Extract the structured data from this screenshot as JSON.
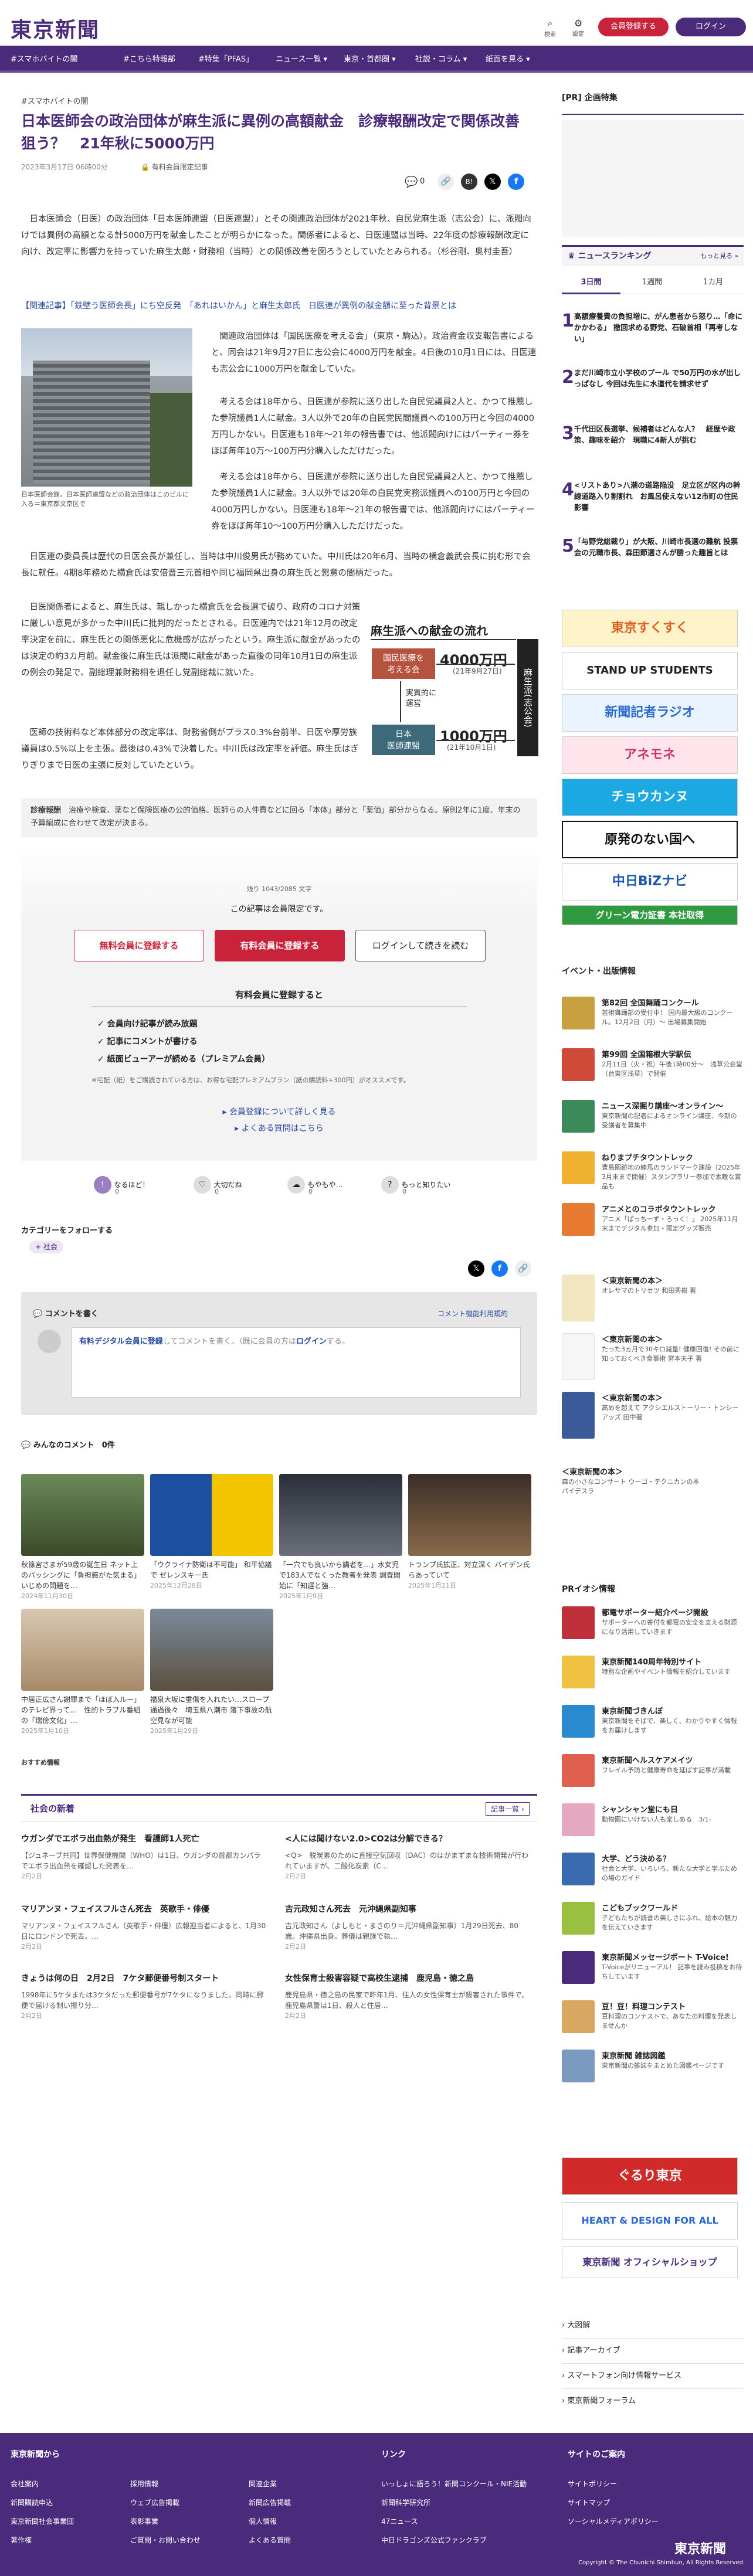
{
  "header": {
    "logo": "東京新聞",
    "search": "検索",
    "settings": "設定",
    "signup": "会員登録する",
    "login": "ログイン"
  },
  "nav": [
    "#スマホバイトの闇",
    "#こちら特報部",
    "#特集「PFAS」",
    "ニュース一覧 ▾",
    "東京・首都圏 ▾",
    "社説・コラム ▾",
    "紙面を見る ▾"
  ],
  "article": {
    "tag": "#スマホバイトの闇",
    "title": "日本医師会の政治団体が麻生派に異例の高額献金　診療報酬改定で関係改善狙う？　21年秋に5000万円",
    "date": "2023年3月17日 06時00分",
    "members_only": "有料会員限定記事",
    "lead": "日本医師会（日医）の政治団体「日本医師連盟（日医連盟）」とその関連政治団体が2021年秋、自民党麻生派（志公会）に、派閥向けでは異例の高額となる計5000万円を献金したことが明らかになった。関係者によると、日医連盟は当時、22年度の診療報酬改定に向け、改定率に影響力を持っていた麻生太郎・財務相（当時）との関係改善を図ろうとしていたとみられる。（杉谷剛、奥村圭吾）",
    "related": "【関連記事】「鉄壁う医師会長」にち空反発　「あれはいかん」と麻生太郎氏　日医連が異例の献金額に至った背景とは",
    "p1": "関連政治団体は「国民医療を考える会」（東京・駒込）。政治資金収支報告書によると、同会は21年9月27日に志公会に4000万円を献金。4日後の10月1日には、日医連も志公会に1000万円を献金していた。",
    "p2": "考える会は18年から、日医連が参院に送り出した自民党議員2人と、かつて推薦した参院議員1人に献金。3人以外で20年の自民党民間議員への100万円と今回の4000万円しかない。日医連も18年〜21年の報告書では、他派閥向けにはパーティー券をほぼ毎年10万〜100万円分購入しただけだった。",
    "p3": "考える会は18年から、日医連が参院に送り出した自民党議員2人と、かつて推薦した参院議員1人に献金。3人以外では20年の自民党実務派議員への100万円と今回の4000万円しかない。日医連も18年〜21年の報告書では、他派閥向けにはパーティー券をほぼ毎年10〜100万円分購入しただけだった。",
    "p4": "日医連の委員長は歴代の日医会長が兼任し、当時は中川俊男氏が務めていた。中川氏は20年6月、当時の横倉義武会長に挑む形で会長に就任。4期8年務めた横倉氏は安倍晋三元首相や同じ福岡県出身の麻生氏と懇意の間柄だった。",
    "p5": "日医関係者によると、麻生氏は、親しかった横倉氏を会長選で破り、政府のコロナ対策に厳しい意見が多かった中川氏に批判的だったとされる。日医連内では21年12月の改定率決定を前に、麻生氏との関係悪化に危機感が広がったという。麻生派に献金があったのは決定の約3カ月前。献金後に麻生氏は派閥に献金があった直後の同年10月1日の麻生派の例会の発足で、副総理兼財務相を退任し党副総裁に就いた。",
    "p6": "医師の技術料など本体部分の改定率は、財務省側がプラス0.3%台前半、日医や厚労族議員は0.5%以上を主張。最後は0.43%で決着した。中川氏は改定率を評価。麻生氏はぎりぎりまで日医の主張に反対していたという。",
    "photo_caption": "日本医師会館。日本医師連盟などの政治団体はこのビルに入る＝東京都文京区で",
    "note_label": "診療報酬",
    "note": "治療や検査、薬など保険医療の公的価格。医師らの人件費などに回る「本体」部分と「薬価」部分からなる。原則2年に1度、年末の予算編成に合わせて改定が決まる。",
    "share_count": "0"
  },
  "diagram": {
    "title": "麻生派への献金の流れ",
    "box1": "国民医療を\n考える会",
    "amt1": "4000万円",
    "date1": "(21年9月27日)",
    "box2": "日本\n医師連盟",
    "amt2": "1000万円",
    "date2": "(21年10月1日)",
    "mid": "実質的に\n運営",
    "dest": "麻生派(志公会)"
  },
  "paywall": {
    "remaining": "残り 1043/2085 文字",
    "msg": "この記事は会員限定です。",
    "free": "無料会員に登録する",
    "paid": "有料会員に登録する",
    "login": "ログインして続きを読む",
    "benefit_title": "有料会員に登録すると",
    "benefits": [
      "会員向け記事が読み放題",
      "記事にコメントが書ける",
      "紙面ビューアーが読める（プレミアム会員）"
    ],
    "fine": "※宅配（紙）をご購読されている方は、お得な宅配プレミアムプラン（紙の購読料+300円）がオススメです。",
    "more1": "会員登録について詳しく見る",
    "more2": "よくある質問はこちら"
  },
  "reactions": [
    "なるほど！",
    "大切だね",
    "もやもや…",
    "もっと知りたい"
  ],
  "reaction_counts": [
    "0",
    "0",
    "0",
    "0"
  ],
  "follow": {
    "label": "カテゴリーをフォローする",
    "chip": "社会"
  },
  "comment": {
    "title": "コメントを書く",
    "help": "コメント機能利用規約",
    "placeholder_a": "有料デジタル会員に登録",
    "placeholder_b": "してコメントを書く。（既に会員の方は",
    "placeholder_c": "ログイン",
    "placeholder_d": "する。"
  },
  "everyone": {
    "title": "みんなのコメント",
    "count": "0件"
  },
  "recs": [
    {
      "cap": "秋篠宮さまが59歳の誕生日 ネット上のバッシングに「負担感がた気まる」 いじめの問題を…",
      "date": "2024年11月30日"
    },
    {
      "cap": "「ウクライナ防衛は不可能」 和平協議で ゼレンスキー氏",
      "date": "2025年12月28日"
    },
    {
      "cap": "「一穴でも良いから講者を…」水女児で183人でなくった教者を発表 調査開始に「知遅と強…",
      "date": "2025年1月9日"
    },
    {
      "cap": "トランプ氏拡正、対立深く バイデン氏らあっていて",
      "date": "2025年1月21日"
    },
    {
      "cap": "中居正広さん謝罪まで「ほぼ入ルー」のテレビ界って…　性的トラブル番組の「瑞傍文化」…",
      "date": "2025年1月10日"
    },
    {
      "cap": "福泉大坂に重傷を入れたい…スロープ通過後々　埼玉県八潮市 落下事故の航空見なが可能",
      "date": "2025年1月29日"
    }
  ],
  "recommend_label": "おすすめ情報",
  "society": {
    "title": "社会の新着",
    "more": "記事一覧 ›",
    "items": [
      {
        "t": "ウガンダでエボラ出血熱が発生　看護師1人死亡",
        "d": "【ジュネーブ共同】世界保健機関（WHO）は1日、ウガンダの首都カンパラでエボラ出血熱を確認した発表を…",
        "date": "2月2日"
      },
      {
        "t": "<人には聞けない2.0>CO2は分解できる？",
        "d": "<Q>　脱炭素のために直接空気回収（DAC）のはかまずまな技術開発が行われていますが、二酸化炭素（C…",
        "date": "2月2日"
      },
      {
        "t": "マリアンヌ・フェイスフルさん死去　英歌手・俳優",
        "d": "マリアンヌ・フェイスフルさん（英歌手・俳優）広報担当者によると、1月30日にロンドンで死去。…",
        "date": "2月2日"
      },
      {
        "t": "吉元政知さん死去　元沖縄県副知事",
        "d": "吉元政知さん（よしもと・まさのり＝元沖縄県副知事）1月29日死去、80歳。沖縄県出身。葬儀は親族で執…",
        "date": "2月2日"
      },
      {
        "t": "きょうは何の日　2月2日　7ケタ郵便番号制スタート",
        "d": "1998年に5ケタまたは3ケタだった郵便番号が7ケタになりました。同時に郵便で届ける制い振り分…",
        "date": "2月2日"
      },
      {
        "t": "女性保育士殺害容疑で高校生逮捕　鹿児島・徳之島",
        "d": "鹿児島県・徳之島の民家で昨年1月、住人の女性保育士が殺害された事件で、鹿児島県警は1日、殺人と住居…",
        "date": "2月2日"
      }
    ]
  },
  "sidebar": {
    "pr": "[PR] 企画特集",
    "ranking": "ニュースランキング",
    "more": "もっと見る »",
    "tabs": [
      "3日間",
      "1週間",
      "1カ月"
    ],
    "rank_items": [
      "高額療養費の負担増に、がん患者から怒り…「命にかかわる」 撤回求める野党、石破首相「再考しない」",
      "まだ川崎市立小学校のプール で50万円の水が出しっぱなし 今回は先生に水道代を請求せず",
      "千代田区長選挙、候補者はどんな人？　経歴や政策、趣味を紹介　現職に4新人が挑む",
      "<リストあり>八潮の道路陥没　足立区が区内の幹線道路入り割割れ　お風呂使えない12市町の住民影響",
      "「与野党総裁り」が大阪、川崎市長選の難航 投票会の元職市長、森田節選さんが勝った趣旨とは"
    ],
    "banners": [
      "東京すくすく",
      "STAND UP STUDENTS",
      "新聞記者ラジオ",
      "アネモネ",
      "チョウカンヌ",
      "原発のない国へ",
      "中日BiZナビ",
      "グリーン電力証書 本社取得"
    ],
    "events_title": "イベント・出版情報",
    "events": [
      {
        "t": "第82回 全国舞踊コンクール",
        "d": "芸術舞踊部の受付中！ 国内最大級のコンクール。12月2日（月）〜 出場募集開始"
      },
      {
        "t": "第99回 全国箱根大学駅伝",
        "d": "2月11日（火・祝）午後1時00分〜　浅草公会堂（台東区浅草）で開催"
      },
      {
        "t": "ニュース深掘り講座〜オンライン〜",
        "d": "東京新聞の記者によるオンライン講座、今期の受講者を募集中"
      },
      {
        "t": "ねりまプチタウントレック",
        "d": "豊島園跡地の練馬のランドマーク建設（2025年3月末まで開催）スタンプラリー参加で素敵な賞品も"
      },
      {
        "t": "アニメとのコラボタウントレック",
        "d": "アニメ「ぱっちーず・ろっく！」 2025年11月末までデジタル参加・限定グッズ販売"
      },
      {
        "t": "＜東京新聞の本＞",
        "d": "オレサマのトリセツ 和田秀樹 著"
      },
      {
        "t": "＜東京新聞の本＞",
        "d": "たった3ヵ月で30キロ減量! 健康回復! その前に知っておくべき食事術 宮本夫子 著"
      },
      {
        "t": "＜東京新聞の本＞",
        "d": "高めを超えて アクシエルストーリー・トンシーアッズ 田中著"
      },
      {
        "t": "＜東京新聞の本＞",
        "d": "森の小さなコンサート ウーゴ・テクニカンの本 パイデスラ"
      }
    ],
    "pr_title": "PRイオシ情報",
    "pr_items": [
      {
        "t": "都電サポーター紹介ページ開設",
        "d": "サポーターへの寄付を都電の安全を支える財源になり活用していきます"
      },
      {
        "t": "東京新聞140周年特別サイト",
        "d": "特別な企画やイベント情報を紹介しています"
      },
      {
        "t": "東京新聞づきんぼ",
        "d": "東京新聞をそばで、楽しく、わかりやすく情報をお届けします"
      },
      {
        "t": "東京新聞ヘルスケアメイツ",
        "d": "フレイル予防と健康寿命を延ばす記事が満載"
      },
      {
        "t": "シャンシャン堂にも日",
        "d": "動物園にいけない人も楽しめる　3/1-"
      },
      {
        "t": "大学、どう決める？",
        "d": "社会と大学、いろいろ、新たな大学と学ぶための場のガイド"
      },
      {
        "t": "こどもブックワールド",
        "d": "子どもたちが読書の楽しさにふれ、絵本の魅力を伝えていきます"
      },
      {
        "t": "東京新聞メッセージポート T-Voice!",
        "d": "T-Voiceがリニューアル！ 記事を読み投稿をお待ちしています"
      },
      {
        "t": "豆！豆！料理コンテスト",
        "d": "豆料理のコンテストで、あなたの料理を発表しませんか"
      },
      {
        "t": "東京新聞 雑誌図鑑",
        "d": "東京新聞の雑誌をまとめた図鑑ページです"
      }
    ],
    "bottom_banners": [
      "ぐるり東京",
      "HEART & DESIGN FOR ALL",
      "東京新聞 オフィシャルショップ"
    ],
    "links": [
      "大図解",
      "記事アーカイブ",
      "スマートフォン向け情報サービス",
      "東京新聞フォーラム"
    ]
  },
  "footer": {
    "col1_title": "東京新聞から",
    "col2_title": "リンク",
    "col3_title": "サイトのご案内",
    "col1": [
      "会社案内",
      "新聞購読申込",
      "東京新聞社会事業団",
      "著作権",
      "採用情報",
      "ウェブ広告掲載",
      "表彰事業",
      "ご質問・お問い合わせ",
      "関連企業",
      "新聞広告掲載",
      "個人情報",
      "よくある質問"
    ],
    "col2": [
      "いっしょに語ろう！新聞コンクール・NIE活動",
      "新聞科学研究所",
      "47ニュース",
      "中日ドラゴンズ公式ファンクラブ"
    ],
    "col3": [
      "サイトポリシー",
      "サイトマップ",
      "ソーシャルメディアポリシー"
    ],
    "logo": "東京新聞",
    "copyright": "Copyright © The Chunichi Shimbun, All Rights Reserved."
  }
}
